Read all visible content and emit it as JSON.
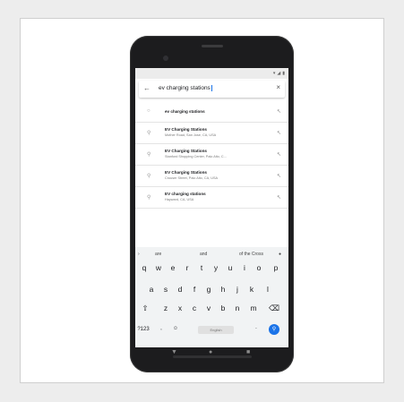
{
  "search": {
    "query": "ev charging stations"
  },
  "results": [
    {
      "title": "ev charging stations",
      "subtitle": "",
      "icon": "search-icon"
    },
    {
      "title": "EV Charging Stations",
      "subtitle": "Mother Road, San Jose, CA, USA",
      "icon": "place-icon"
    },
    {
      "title": "EV Charging Stations",
      "subtitle": "Stanford Shopping Center, Palo Alto, C...",
      "icon": "place-icon"
    },
    {
      "title": "EV Charging Stations",
      "subtitle": "Crouser Street, Palo Alto, CA, USA",
      "icon": "place-icon"
    },
    {
      "title": "EV charging stations",
      "subtitle": "Hayward, CA, USA",
      "icon": "place-icon"
    }
  ],
  "keyboard": {
    "suggestions": [
      "are",
      "and",
      "of the Cross"
    ],
    "row1": [
      "q",
      "w",
      "e",
      "r",
      "t",
      "y",
      "u",
      "i",
      "o",
      "p"
    ],
    "row2": [
      "a",
      "s",
      "d",
      "f",
      "g",
      "h",
      "j",
      "k",
      "l"
    ],
    "row3": [
      "z",
      "x",
      "c",
      "v",
      "b",
      "n",
      "m"
    ],
    "sym": "?123",
    "comma": ",",
    "period": ".",
    "space_label": "English"
  }
}
